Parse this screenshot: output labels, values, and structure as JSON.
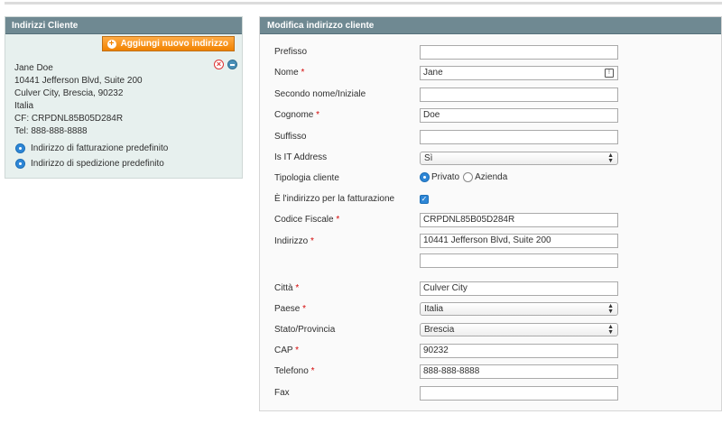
{
  "left": {
    "title": "Indirizzi Cliente",
    "add_button": "Aggiungi nuovo indirizzo",
    "address_lines": [
      "Jane Doe",
      "10441 Jefferson Blvd, Suite 200",
      "Culver City, Brescia, 90232",
      "Italia",
      "CF: CRPDNL85B05D284R",
      "Tel: 888-888-8888"
    ],
    "default_billing": "Indirizzo di fatturazione predefinito",
    "default_shipping": "Indirizzo di spedizione predefinito"
  },
  "right": {
    "title": "Modifica indirizzo cliente",
    "labels": {
      "prefix": "Prefisso",
      "firstname": "Nome",
      "middlename": "Secondo nome/Iniziale",
      "lastname": "Cognome",
      "suffix": "Suffisso",
      "is_it": "Is IT Address",
      "customer_type": "Tipologia cliente",
      "is_billing": "È l'indirizzo per la fatturazione",
      "fiscal_code": "Codice Fiscale",
      "street": "Indirizzo",
      "city": "Città",
      "country": "Paese",
      "region": "Stato/Provincia",
      "postcode": "CAP",
      "telephone": "Telefono",
      "fax": "Fax"
    },
    "values": {
      "prefix": "",
      "firstname": "Jane",
      "middlename": "",
      "lastname": "Doe",
      "suffix": "",
      "is_it": "Sì",
      "customer_type_private": "Privato",
      "customer_type_company": "Azienda",
      "fiscal_code": "CRPDNL85B05D284R",
      "street1": "10441 Jefferson Blvd, Suite 200",
      "street2": "",
      "city": "Culver City",
      "country": "Italia",
      "region": "Brescia",
      "postcode": "90232",
      "telephone": "888-888-8888",
      "fax": ""
    },
    "required_marker": "*"
  },
  "icons": {
    "add": "plus-icon",
    "delete": "delete-icon",
    "edit": "edit-icon",
    "contact_card": "contact-card-icon",
    "select_arrow": "updown-arrow-icon"
  },
  "colors": {
    "panel_header": "#6f8992",
    "left_bg": "#e7f0ee",
    "add_button": "#f18200",
    "required": "#d40707",
    "radio": "#2e86d6"
  }
}
